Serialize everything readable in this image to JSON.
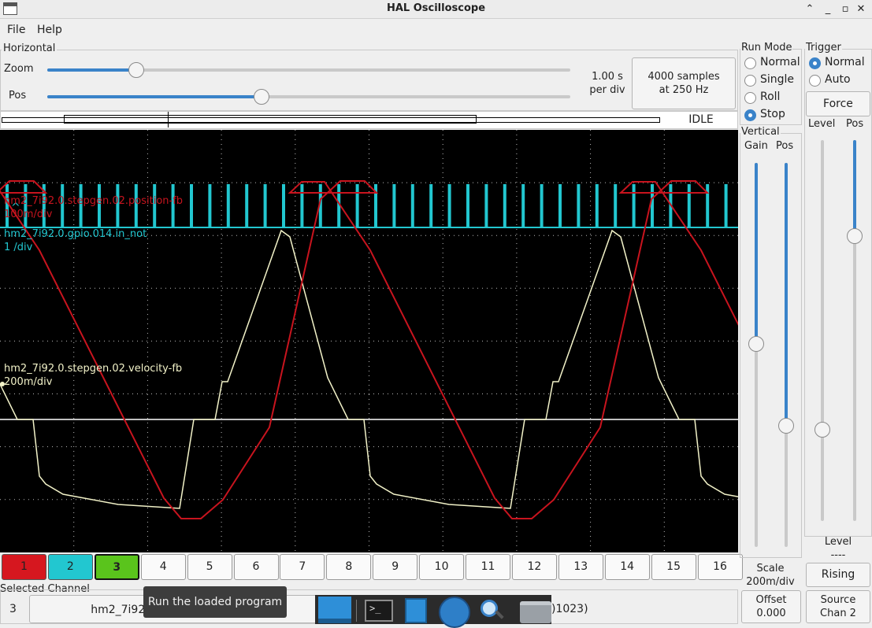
{
  "window": {
    "title": "HAL Oscilloscope"
  },
  "menu": {
    "file": "File",
    "help": "Help"
  },
  "horizontal": {
    "label": "Horizontal",
    "zoom_label": "Zoom",
    "zoom_level": 0.17,
    "pos_label": "Pos",
    "pos_level": 0.41,
    "time_per_div_value": "1.00 s",
    "time_per_div_unit": "per div",
    "samples_line1": "4000 samples",
    "samples_line2": "at 250 Hz",
    "status": "IDLE"
  },
  "run_mode": {
    "label": "Run Mode",
    "options": [
      "Normal",
      "Single",
      "Roll",
      "Stop"
    ],
    "selected": "Stop"
  },
  "trigger": {
    "label": "Trigger",
    "options": [
      "Normal",
      "Auto"
    ],
    "selected": "Normal",
    "force_label": "Force",
    "level_label": "Level",
    "pos_label": "Pos",
    "level_value_label": "Level",
    "level_value": "----",
    "edge_button": "Rising",
    "source_line1": "Source",
    "source_line2": "Chan  2"
  },
  "vertical": {
    "label": "Vertical",
    "gain_label": "Gain",
    "pos_label": "Pos",
    "scale_label": "Scale",
    "scale_value": "200m/div",
    "offset_label": "Offset",
    "offset_value": "0.000"
  },
  "traces": [
    {
      "name": "hm2_7i92.0.stepgen.02.position-fb",
      "scale": "100m/div",
      "color": "#c8141e"
    },
    {
      "name": "hm2_7i92.0.gpio.014.in_not",
      "scale": "1 /div",
      "color": "#22c7d0"
    },
    {
      "name": "hm2_7i92.0.stepgen.02.velocity-fb",
      "scale": "200m/div",
      "color": "#f2f2c8"
    }
  ],
  "channels": [
    {
      "label": "1",
      "color": "#d6171f"
    },
    {
      "label": "2",
      "color": "#22c7d0"
    },
    {
      "label": "3",
      "color": "#5ac41c"
    },
    {
      "label": "4"
    },
    {
      "label": "5"
    },
    {
      "label": "6"
    },
    {
      "label": "7"
    },
    {
      "label": "8"
    },
    {
      "label": "9"
    },
    {
      "label": "10"
    },
    {
      "label": "11"
    },
    {
      "label": "12"
    },
    {
      "label": "13"
    },
    {
      "label": "14"
    },
    {
      "label": "15"
    },
    {
      "label": "16"
    }
  ],
  "selected_channel": {
    "label": "Selected Channel",
    "number": "3",
    "signal": "hm2_7i92.0.stepgen.02.velocity-fb",
    "extra_text": ")1023)"
  },
  "tooltip": {
    "text": "Run the loaded program"
  },
  "taskbar": {
    "icons": [
      "desktop-icon",
      "terminal-icon",
      "file-cabinet-icon",
      "globe-icon",
      "magnifier-icon",
      "folder-icon"
    ]
  }
}
